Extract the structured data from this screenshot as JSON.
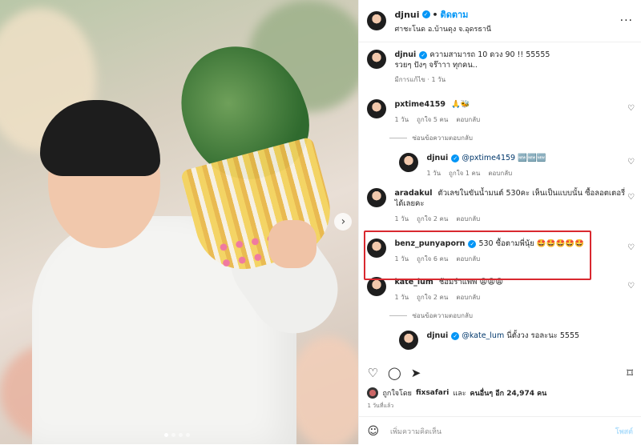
{
  "post": {
    "username": "djnui",
    "follow_label": "ติดตาม",
    "separator": "•",
    "location": "ศาชะโนด อ.บ้านดุง จ.อุดรธานี",
    "caption_line1": "ความสามารถ 10 ดวง 90 !! 55555",
    "caption_line2": "รวยๆ ปังๆ จร๊าาา ทุกคน..",
    "caption_meta": "มีการแก้ไข · 1 วัน"
  },
  "comments": [
    {
      "user": "pxtime4159",
      "text": "🙏🐝",
      "age": "1 วัน",
      "likes": "ถูกใจ 5 คน",
      "reply": "ตอบกลับ"
    },
    {
      "toggle": "ซ่อนข้อความตอบกลับ"
    },
    {
      "user": "djnui",
      "mention": "@pxtime4159",
      "text": "🆕🆕🆕",
      "age": "1 วัน",
      "likes": "ถูกใจ 1 คน",
      "reply": "ตอบกลับ"
    },
    {
      "user": "aradakul",
      "text": "ตัวเลขในขันน้ำมนต์ 530คะ เห็นเป็นแบบนั้น ซื้อลอตเตอรี่ได้เลยคะ",
      "age": "1 วัน",
      "likes": "ถูกใจ 2 คน",
      "reply": "ตอบกลับ"
    },
    {
      "user": "benz_punyaporn",
      "text": "530 ซื้อตามพี่นุ้ย 🤩🤩🤩🤩🤩",
      "age": "1 วัน",
      "likes": "ถูกใจ 6 คน",
      "reply": "ตอบกลับ"
    },
    {
      "user": "kate_lum",
      "text": "ช้อมรำแพพ 😩😩😩",
      "age": "1 วัน",
      "likes": "ถูกใจ 2 คน",
      "reply": "ตอบกลับ"
    },
    {
      "toggle": "ซ่อนข้อความตอบกลับ"
    },
    {
      "user": "djnui",
      "mention": "@kate_lum",
      "text": "นี่ตั้งวง รอละนะ 5555"
    }
  ],
  "likes": {
    "prefix": "ถูกใจโดย",
    "by": "fixsafari",
    "middle": "และ",
    "others": "คนอื่นๆ อีก 24,974 คน"
  },
  "timestamp": "1 วันที่แล้ว",
  "add_comment": {
    "placeholder": "เพิ่มความคิดเห็น",
    "post_label": "โพสต์"
  },
  "icons": {
    "more": "more-horizontal-icon",
    "heart": "heart-outline-icon",
    "comment": "comment-icon",
    "share": "share-icon",
    "save": "bookmark-icon",
    "emoji": "emoji-icon",
    "next": "chevron-right-icon"
  },
  "colors": {
    "accent": "#0095f6",
    "highlight": "#d9282f"
  }
}
